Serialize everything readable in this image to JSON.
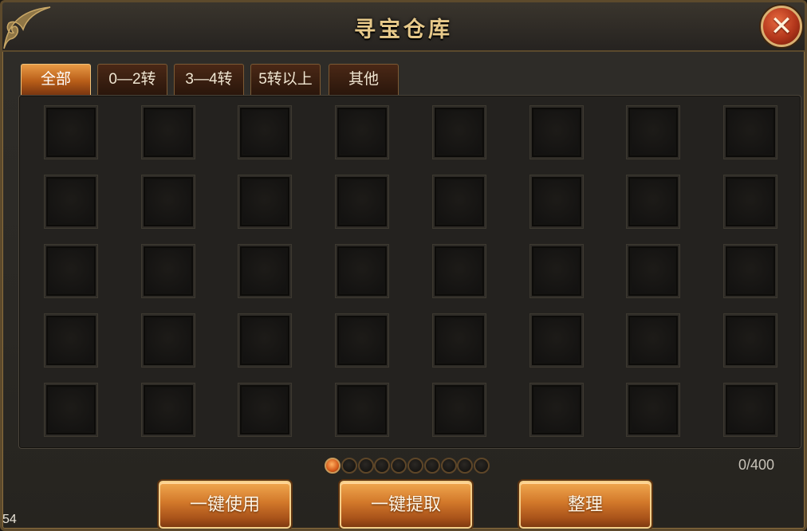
{
  "window": {
    "title": "寻宝仓库",
    "close_label": "✕"
  },
  "tabs": [
    {
      "label": "全部",
      "active": true
    },
    {
      "label": "0—2转",
      "active": false
    },
    {
      "label": "3—4转",
      "active": false
    },
    {
      "label": "5转以上",
      "active": false
    },
    {
      "label": "其他",
      "active": false
    }
  ],
  "inventory": {
    "columns": 8,
    "rows": 5,
    "count_text": "0/400"
  },
  "pager": {
    "total_pages": 10,
    "current_page": 1
  },
  "buttons": {
    "use_all": "一键使用",
    "extract_all": "一键提取",
    "sort": "整理"
  },
  "corner_text": "54",
  "colors": {
    "title": "#e7c98a",
    "active_tab": "#e89a45",
    "button": "#d2782a",
    "close": "#b2361b"
  }
}
